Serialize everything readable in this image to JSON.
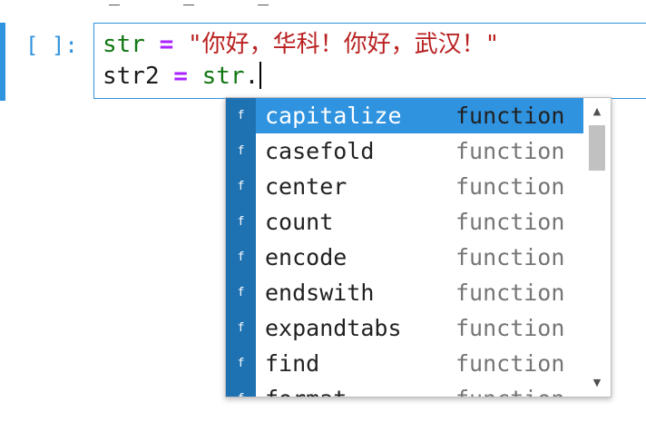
{
  "cell": {
    "prompt": "[ ]:",
    "line1": {
      "var": "str",
      "op": " = ",
      "string": "\"你好，华科！你好，武汉！\""
    },
    "line2": {
      "var": "str2",
      "op": " = ",
      "obj": "str",
      "dot": "."
    }
  },
  "completer": {
    "items": [
      {
        "type": "f",
        "label": "capitalize",
        "kind": "function",
        "active": true
      },
      {
        "type": "f",
        "label": "casefold",
        "kind": "function"
      },
      {
        "type": "f",
        "label": "center",
        "kind": "function"
      },
      {
        "type": "f",
        "label": "count",
        "kind": "function"
      },
      {
        "type": "f",
        "label": "encode",
        "kind": "function"
      },
      {
        "type": "f",
        "label": "endswith",
        "kind": "function"
      },
      {
        "type": "f",
        "label": "expandtabs",
        "kind": "function"
      },
      {
        "type": "f",
        "label": "find",
        "kind": "function"
      },
      {
        "type": "f",
        "label": "format",
        "kind": "function"
      }
    ]
  },
  "colors": {
    "accent": "#2f93e0",
    "type_badge": "#1f72b2",
    "variable": "#117711",
    "operator": "#aa22ff",
    "string": "#ba2121"
  }
}
